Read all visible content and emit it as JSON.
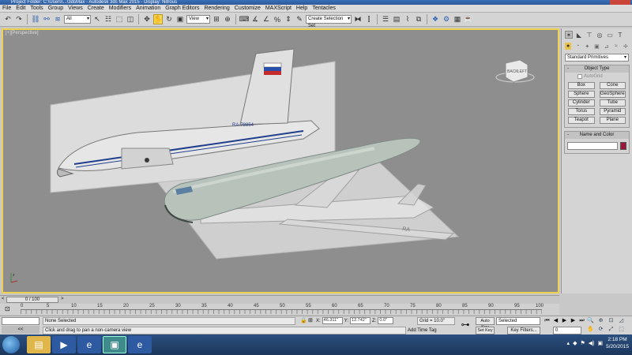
{
  "titlebar": {
    "app_icon": "3ds-max-icon",
    "title": "Project Folder: C:\\Users\\...\\3dsMax  -  Autodesk 3ds Max 2015  -  Display: Nitrous"
  },
  "menu": [
    "File",
    "Edit",
    "Tools",
    "Group",
    "Views",
    "Create",
    "Modifiers",
    "Animation",
    "Graph Editors",
    "Rendering",
    "Customize",
    "MAXScript",
    "Help",
    "Tentacles"
  ],
  "toolbar": {
    "filter_value": "All",
    "ref_coord_value": "View",
    "selection_set_placeholder": "Create Selection Set"
  },
  "viewport": {
    "label": "[+][Perspective]",
    "viewcube_front": "BACK",
    "viewcube_side": "LEFT",
    "reference_reg": "RA-78854",
    "accent": "#f0d050"
  },
  "command_panel": {
    "category": "Standard Primitives",
    "object_type_title": "Object Type",
    "autogrid_label": "AutoGrid",
    "objects": [
      "Box",
      "Cone",
      "Sphere",
      "GeoSphere",
      "Cylinder",
      "Tube",
      "Torus",
      "Pyramid",
      "Teapot",
      "Plane"
    ],
    "name_color_title": "Name and Color",
    "object_color": "#9a1a3e"
  },
  "time_slider": {
    "position": "0 / 100",
    "prev": "<",
    "next": ">"
  },
  "track": {
    "ticks": [
      "0",
      "5",
      "10",
      "15",
      "20",
      "25",
      "30",
      "35",
      "40",
      "45",
      "50",
      "55",
      "60",
      "65",
      "70",
      "75",
      "80",
      "85",
      "90",
      "95",
      "100"
    ]
  },
  "status": {
    "maxscript_arrows": "<<",
    "selection_message": "None Selected",
    "prompt_message": "Click and drag to pan a non-camera view",
    "x_label": "X:",
    "x_value": "46.311\"",
    "y_label": "Y:",
    "y_value": "12.742\"",
    "z_label": "Z:",
    "z_value": "0.0\"",
    "grid": "Grid = 10.0\"",
    "add_time_tag": "Add Time Tag",
    "auto_key": "Auto Key",
    "set_key": "Set Key",
    "key_mode": "Selected",
    "key_filters": "Key Filters...",
    "current_frame": "0"
  },
  "taskbar": {
    "time": "2:18 PM",
    "date": "5/20/2015"
  }
}
